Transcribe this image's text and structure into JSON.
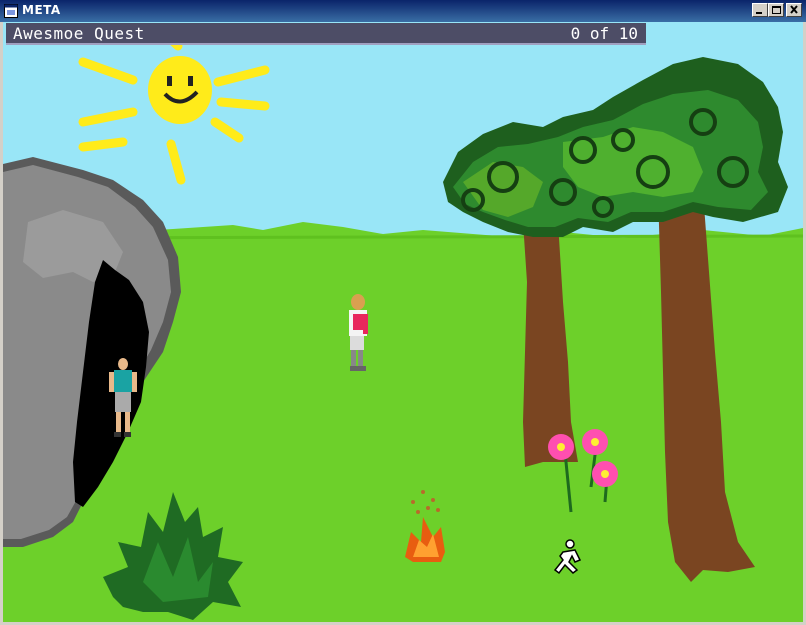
{
  "window": {
    "title": "META",
    "controls": {
      "minimize": "minimize",
      "maximize": "maximize",
      "close": "close"
    }
  },
  "game": {
    "title": "Awesmoe Quest",
    "score": "0 of 10"
  },
  "colors": {
    "titlebar": "#0a246a",
    "sky": "#99e6f7",
    "grass": "#6dd02a",
    "statusbar": "#4d4d66"
  }
}
